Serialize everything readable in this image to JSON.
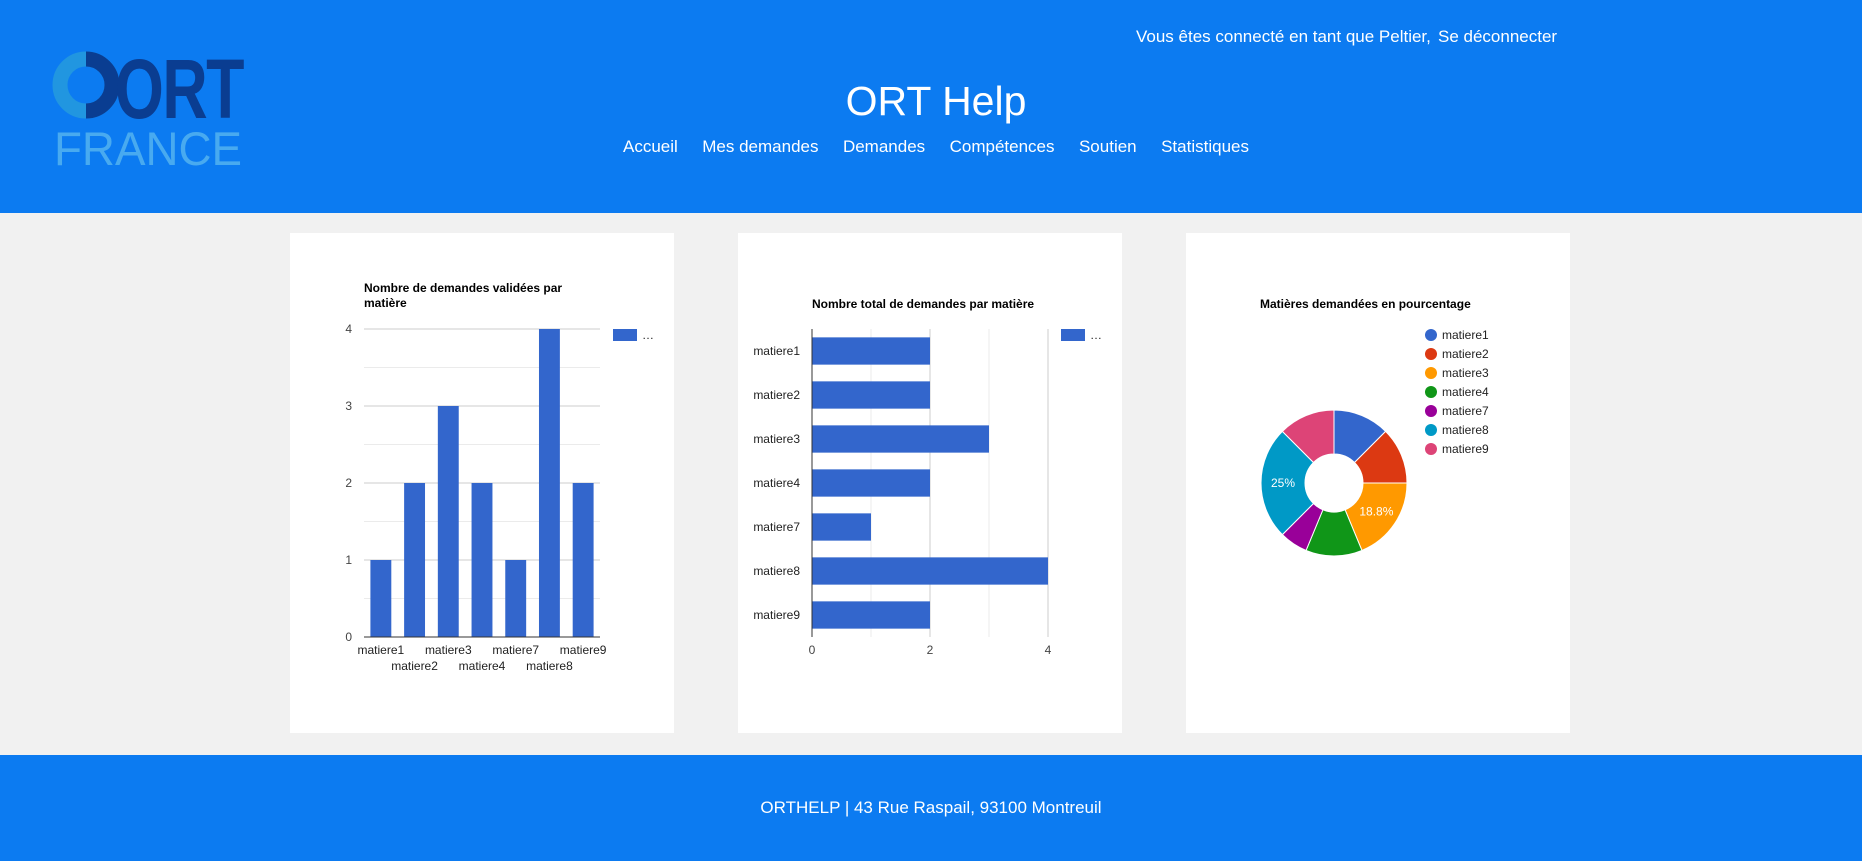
{
  "header": {
    "logo": {
      "top": "ORT",
      "bottom": "FRANCE"
    },
    "user_text": "Vous êtes connecté en tant que Peltier,",
    "logout_label": "Se déconnecter",
    "site_title": "ORT Help",
    "nav": [
      "Accueil",
      "Mes demandes",
      "Demandes",
      "Compétences",
      "Soutien",
      "Statistiques"
    ]
  },
  "chart_data": [
    {
      "type": "bar",
      "title": "Nombre de demandes validées par matière",
      "categories": [
        "matiere1",
        "matiere2",
        "matiere3",
        "matiere4",
        "matiere7",
        "matiere8",
        "matiere9"
      ],
      "values": [
        1,
        2,
        3,
        2,
        1,
        4,
        2
      ],
      "ylim": [
        0,
        4
      ],
      "yticks": [
        0,
        1,
        2,
        3,
        4
      ],
      "legend": "…",
      "legend_position": "right",
      "color": "#3366cc",
      "grid": true
    },
    {
      "type": "bar",
      "orientation": "horizontal",
      "title": "Nombre total de demandes par matière",
      "categories": [
        "matiere1",
        "matiere2",
        "matiere3",
        "matiere4",
        "matiere7",
        "matiere8",
        "matiere9"
      ],
      "values": [
        2,
        2,
        3,
        2,
        1,
        4,
        2
      ],
      "xlim": [
        0,
        4
      ],
      "xticks": [
        0,
        2,
        4
      ],
      "legend": "…",
      "legend_position": "right",
      "color": "#3366cc",
      "grid": true
    },
    {
      "type": "pie",
      "donut": true,
      "title": "Matières demandées en pourcentage",
      "labels": [
        "matiere1",
        "matiere2",
        "matiere3",
        "matiere4",
        "matiere7",
        "matiere8",
        "matiere9"
      ],
      "values": [
        2,
        2,
        3,
        2,
        1,
        4,
        2
      ],
      "colors": [
        "#3366cc",
        "#dc3912",
        "#ff9900",
        "#109618",
        "#990099",
        "#0099c6",
        "#dd4477"
      ],
      "slice_labels": [
        "",
        "",
        "18.8%",
        "",
        "",
        "25%",
        ""
      ],
      "legend_position": "right"
    }
  ],
  "footer": {
    "text": "ORTHELP | 43 Rue Raspail, 93100 Montreuil"
  }
}
